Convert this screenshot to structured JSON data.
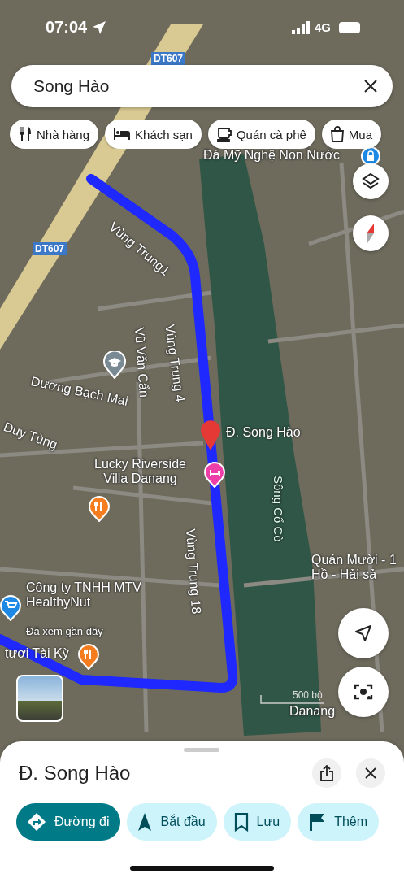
{
  "status_bar": {
    "time": "07:04",
    "network": "4G"
  },
  "search": {
    "value": "Song Hào"
  },
  "chips": [
    {
      "label": "Nhà hàng",
      "kind": "restaurant"
    },
    {
      "label": "Khách sạn",
      "kind": "hotel"
    },
    {
      "label": "Quán cà phê",
      "kind": "cafe"
    },
    {
      "label": "Mua",
      "kind": "shopping"
    }
  ],
  "map": {
    "labels": [
      {
        "text": "DT607",
        "kind": "shield"
      },
      {
        "text": "DT607",
        "kind": "shield"
      },
      {
        "text": "Vùng Trung1",
        "kind": "street"
      },
      {
        "text": "Vùng Trung 4",
        "kind": "street"
      },
      {
        "text": "Vũ Văn Cẩn",
        "kind": "street"
      },
      {
        "text": "Dương Bạch Mai",
        "kind": "street"
      },
      {
        "text": "Duy Tùng",
        "kind": "street"
      },
      {
        "text": "Đ. Song Hào",
        "kind": "place"
      },
      {
        "text": "Lucky Riverside\nVilla Danang",
        "kind": "place"
      },
      {
        "text": "Sông Cổ Cò",
        "kind": "river"
      },
      {
        "text": "Vùng Trung 18",
        "kind": "street"
      },
      {
        "text": "Công ty TNHH MTV\nHealthyNut",
        "kind": "place"
      },
      {
        "text": "Đã xem gần đây",
        "kind": "note"
      },
      {
        "text": "tươi Tài Kỳ",
        "kind": "place"
      },
      {
        "text": "Quán Mười - 1\nHồ - Hải sả",
        "kind": "place"
      },
      {
        "text": "Đá Mỹ Nghệ Non Nước",
        "kind": "place"
      },
      {
        "text": "Danang",
        "kind": "place"
      }
    ],
    "scale": "500 bộ"
  },
  "place": {
    "title": "Đ. Song Hào",
    "actions": [
      {
        "label": "Đường đi",
        "kind": "directions"
      },
      {
        "label": "Bắt đầu",
        "kind": "start"
      },
      {
        "label": "Lưu",
        "kind": "save"
      },
      {
        "label": "Thêm",
        "kind": "add"
      }
    ]
  }
}
